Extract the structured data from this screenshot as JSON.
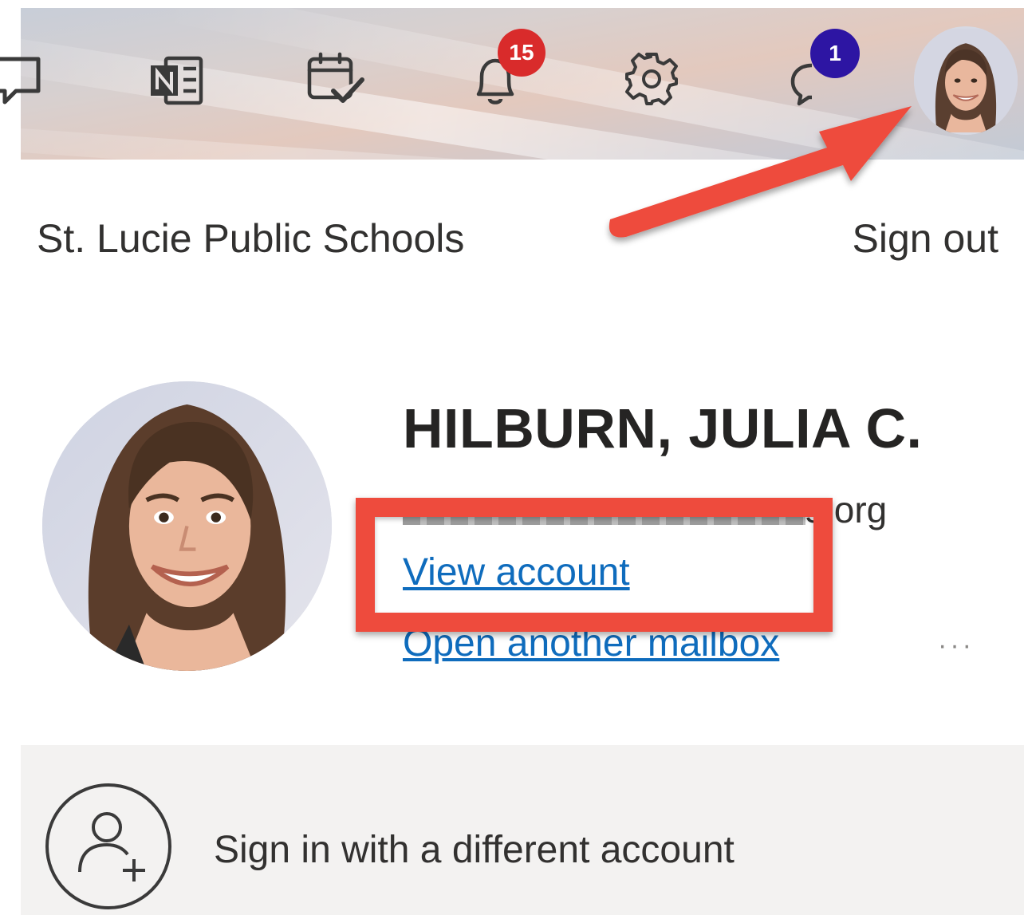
{
  "toolbar": {
    "icons": [
      "chat-icon",
      "onenote-icon",
      "calendar-check-icon",
      "bell-icon",
      "gear-icon",
      "comment-icon"
    ],
    "notifications_count": "15",
    "feedback_count": "1",
    "badge_colors": {
      "notifications": "#d92b2b",
      "feedback": "#2d15a3"
    }
  },
  "account": {
    "organization": "St. Lucie Public Schools",
    "sign_out_label": "Sign out",
    "display_name": "HILBURN, JULIA C.",
    "email_visible_suffix": "s.org",
    "view_account_label": "View account",
    "open_mailbox_label": "Open another mailbox",
    "more_label": "···",
    "link_color": "#0f6cbd"
  },
  "alt_account": {
    "label": "Sign in with a different account",
    "icon": "person-add-icon"
  },
  "annotation": {
    "color": "#ee4b3d",
    "arrow_target": "avatar",
    "highlight_target": "view-account-link"
  }
}
